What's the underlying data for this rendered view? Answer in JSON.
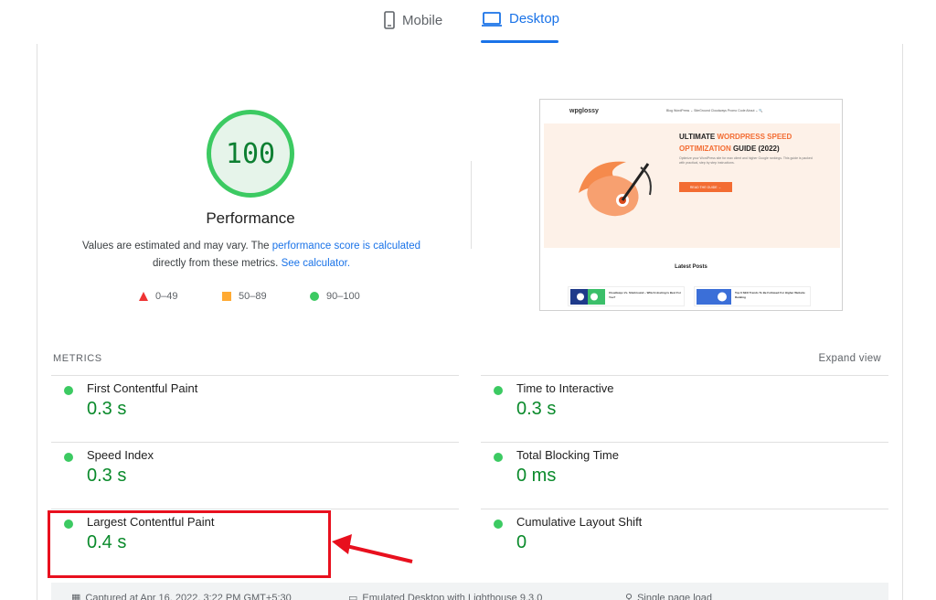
{
  "tabs": {
    "mobile": "Mobile",
    "desktop": "Desktop"
  },
  "score": {
    "value": "100",
    "title": "Performance",
    "desc_prefix": "Values are estimated and may vary. The ",
    "desc_link": "performance score is calculated",
    "desc_mid": "directly from these metrics. ",
    "desc_link2": "See calculator.",
    "legend": {
      "fail": "0–49",
      "average": "50–89",
      "pass": "90–100"
    }
  },
  "preview": {
    "logo": "wpglossy",
    "menu": "Blog   WordPress ⌄   SiteGround   Cloudways Promo Code   About ⌄   🔍",
    "headline_1": "ULTIMATE ",
    "headline_hl1": "WORDPRESS SPEED",
    "headline_hl2": "OPTIMIZATION",
    "headline_2": " GUIDE (2022)",
    "body": "Optimize your WordPress site for max client and higher Google rankings. This guide is packed with practical, step by step instructions.",
    "button": "READ THE GUIDE  →",
    "latest": "Latest Posts",
    "card1": "Cloudways Vs. SiteGround – Which Hosting Is Best For You?",
    "card2": "Top 6 SEO Trends To Be Followed For Higher Website Ranking"
  },
  "metrics": {
    "label": "METRICS",
    "expand": "Expand view",
    "fcp": {
      "name": "First Contentful Paint",
      "value": "0.3 s"
    },
    "tti": {
      "name": "Time to Interactive",
      "value": "0.3 s"
    },
    "si": {
      "name": "Speed Index",
      "value": "0.3 s"
    },
    "tbt": {
      "name": "Total Blocking Time",
      "value": "0 ms"
    },
    "lcp": {
      "name": "Largest Contentful Paint",
      "value": "0.4 s"
    },
    "cls": {
      "name": "Cumulative Layout Shift",
      "value": "0"
    }
  },
  "footer": {
    "captured": "Captured at Apr 16, 2022, 3:22 PM GMT+5:30",
    "emulated": "Emulated Desktop with Lighthouse 9.3.0",
    "load": "Single page load"
  },
  "colors": {
    "pass": "#3cca62",
    "accent": "#1a73e8",
    "highlight": "#e8101e",
    "brand": "#f36c32"
  }
}
